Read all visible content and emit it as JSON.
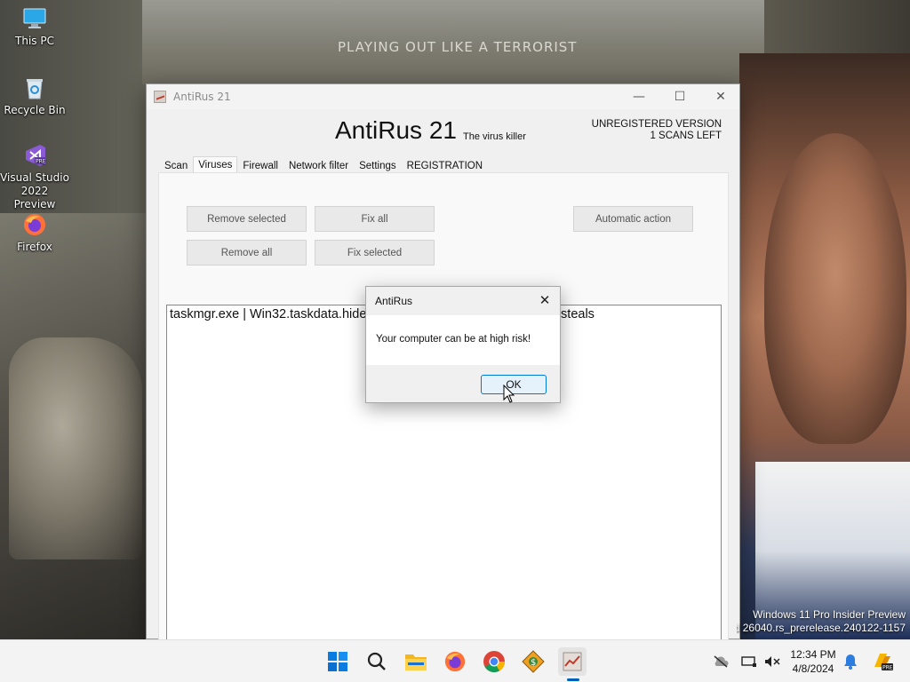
{
  "desktop": {
    "wallpaper_text": "PLAYING OUT LIKE A TERRORIST",
    "icons": [
      {
        "label": "This PC",
        "icon": "monitor-icon"
      },
      {
        "label": "Recycle Bin",
        "icon": "recycle-bin-icon"
      },
      {
        "label_line1": "Visual Studio",
        "label_line2": "2022 Preview",
        "icon": "visual-studio-icon"
      },
      {
        "label": "Firefox",
        "icon": "firefox-icon"
      }
    ]
  },
  "window": {
    "title": "AntiRus 21",
    "controls": {
      "minimize": "—",
      "maximize": "☐",
      "close": "✕"
    },
    "header": {
      "app_name": "AntiRus 21",
      "tagline": "The virus killer",
      "status_line1": "UNREGISTERED VERSION",
      "status_line2": "1 SCANS LEFT"
    },
    "tabs": [
      "Scan",
      "Viruses",
      "Firewall",
      "Network filter",
      "Settings",
      "REGISTRATION"
    ],
    "active_tab": "Viruses",
    "buttons": {
      "remove_selected": "Remove selected",
      "fix_all": "Fix all",
      "automatic_action": "Automatic action",
      "remove_all": "Remove all",
      "fix_selected": "Fix selected"
    },
    "virus_list": [
      "taskmgr.exe | Win32.taskdata.hide | This is a malware proccess and steals"
    ]
  },
  "dialog": {
    "title": "AntiRus",
    "message": "Your computer can be at high risk!",
    "ok_label": "OK",
    "close": "✕"
  },
  "watermark": {
    "line1": "Windows 11 Pro Insider Preview",
    "line2": "Evaluation copy. Build 26040.rs_prerelease.240122-1157"
  },
  "taskbar": {
    "apps": [
      "start-icon",
      "search-icon",
      "file-explorer-icon",
      "firefox-icon",
      "chrome-icon",
      "setup-icon",
      "antirus-icon"
    ],
    "time": "12:34 PM",
    "date": "4/8/2024"
  },
  "colors": {
    "accent": "#0078d7",
    "window_bg": "#f0f0f0",
    "taskbar_bg": "#f3f3f3"
  }
}
